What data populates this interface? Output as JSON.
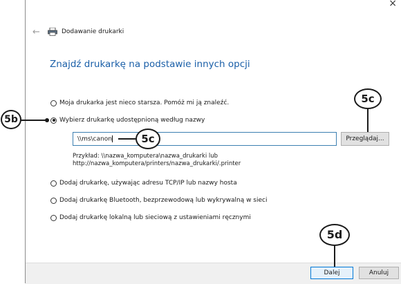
{
  "window": {
    "close_glyph": "×",
    "back_glyph": "←",
    "title": "Dodawanie drukarki"
  },
  "heading": "Znajdź drukarkę na podstawie innych opcji",
  "options": [
    {
      "label": "Moja drukarka jest nieco starsza. Pomóż mi ją znaleźć.",
      "checked": false
    },
    {
      "label": "Wybierz drukarkę udostępnioną według nazwy",
      "checked": true
    },
    {
      "label": "Dodaj drukarkę, używając adresu TCP/IP lub nazwy hosta",
      "checked": false
    },
    {
      "label": "Dodaj drukarkę Bluetooth, bezprzewodową lub wykrywalną w sieci",
      "checked": false
    },
    {
      "label": "Dodaj drukarkę lokalną lub sieciową z ustawieniami ręcznymi",
      "checked": false
    }
  ],
  "name_input": {
    "value": "\\\\ms\\canon"
  },
  "browse_label": "Przeglądaj...",
  "example": {
    "line1": "Przykład: \\\\nazwa_komputera\\nazwa_drukarki lub",
    "line2": "http://nazwa_komputera/printers/nazwa_drukarki/.printer"
  },
  "buttons": {
    "next": "Dalej",
    "cancel": "Anuluj"
  },
  "callouts": {
    "c5b": "5b",
    "c5c_browse": "5c",
    "c5c_input": "5c",
    "c5d": "5d"
  },
  "icons": {
    "printer": "printer-icon",
    "back": "back-arrow-icon",
    "close": "close-icon"
  }
}
